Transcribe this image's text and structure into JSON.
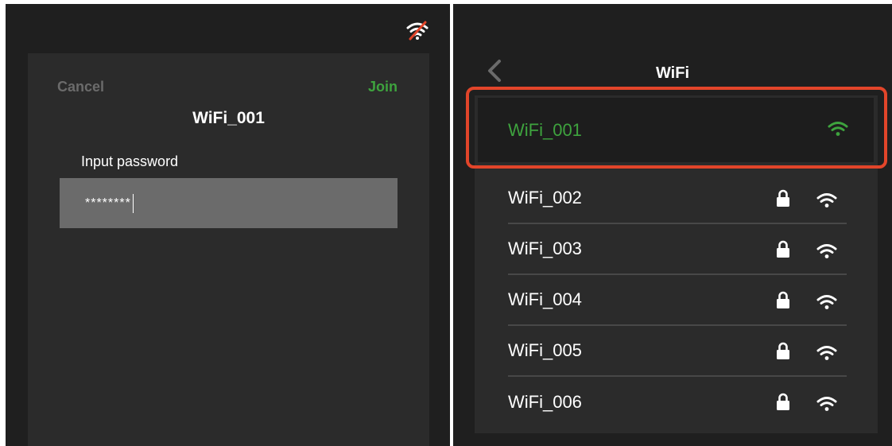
{
  "left_panel": {
    "status_icon": "wifi-disconnected-icon",
    "dialog": {
      "cancel_label": "Cancel",
      "join_label": "Join",
      "title": "WiFi_001",
      "password_label": "Input password",
      "password_value": "********"
    }
  },
  "right_panel": {
    "nav": {
      "back_icon": "chevron-left-icon",
      "title": "WiFi"
    },
    "selected_network": {
      "name": "WiFi_001",
      "icon": "wifi-signal-icon"
    },
    "networks": [
      {
        "name": "WiFi_002",
        "icons": [
          "lock-icon",
          "wifi-signal-icon"
        ]
      },
      {
        "name": "WiFi_003",
        "icons": [
          "lock-icon",
          "wifi-signal-icon"
        ]
      },
      {
        "name": "WiFi_004",
        "icons": [
          "lock-icon",
          "wifi-signal-icon"
        ]
      },
      {
        "name": "WiFi_005",
        "icons": [
          "lock-icon",
          "wifi-signal-icon"
        ]
      },
      {
        "name": "WiFi_006",
        "icons": [
          "lock-icon",
          "wifi-signal-icon"
        ]
      }
    ]
  },
  "colors": {
    "accent_green": "#3ea33e",
    "highlight_red": "#e2452a",
    "screen_bg": "#1f1f1f",
    "panel_bg": "#2b2b2b",
    "input_bg": "#6b6b6b"
  }
}
